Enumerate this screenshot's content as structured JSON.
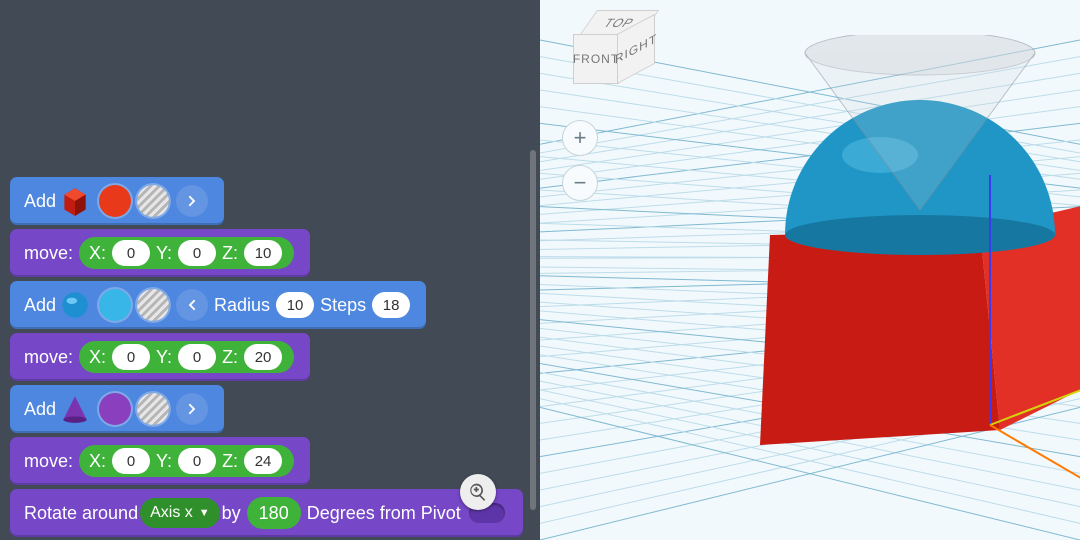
{
  "colors": {
    "block_blue": "#4e87e0",
    "block_purple": "#7647c7",
    "param_green": "#3fb23a",
    "workspace_bg": "#424a56",
    "cube_red": "#d42020",
    "sphere_blue": "#2196c4",
    "cone_purple": "#8a3fbf"
  },
  "blocks": [
    {
      "type": "add",
      "label": "Add",
      "shape_icon": "cube",
      "color_swatch": "#e83a1a",
      "radius_label": null
    },
    {
      "type": "move",
      "label": "move:",
      "x_label": "X:",
      "x": "0",
      "y_label": "Y:",
      "y": "0",
      "z_label": "Z:",
      "z": "10"
    },
    {
      "type": "add",
      "label": "Add",
      "shape_icon": "sphere",
      "color_swatch": "#39b6e8",
      "expanded": true,
      "radius_label": "Radius",
      "radius": "10",
      "steps_label": "Steps",
      "steps": "18"
    },
    {
      "type": "move",
      "label": "move:",
      "x_label": "X:",
      "x": "0",
      "y_label": "Y:",
      "y": "0",
      "z_label": "Z:",
      "z": "20"
    },
    {
      "type": "add",
      "label": "Add",
      "shape_icon": "cone",
      "color_swatch": "#8a3fbf",
      "radius_label": null
    },
    {
      "type": "move",
      "label": "move:",
      "x_label": "X:",
      "x": "0",
      "y_label": "Y:",
      "y": "0",
      "z_label": "Z:",
      "z": "24"
    },
    {
      "type": "rotate",
      "label_a": "Rotate around",
      "axis_label": "Axis x",
      "label_b": "by",
      "angle": "180",
      "label_c": "Degrees from Pivot"
    }
  ],
  "viewcube": {
    "top": "TOP",
    "front": "FRONT",
    "right": "RIGHT"
  },
  "zoom": {
    "in": "+",
    "out": "−"
  }
}
